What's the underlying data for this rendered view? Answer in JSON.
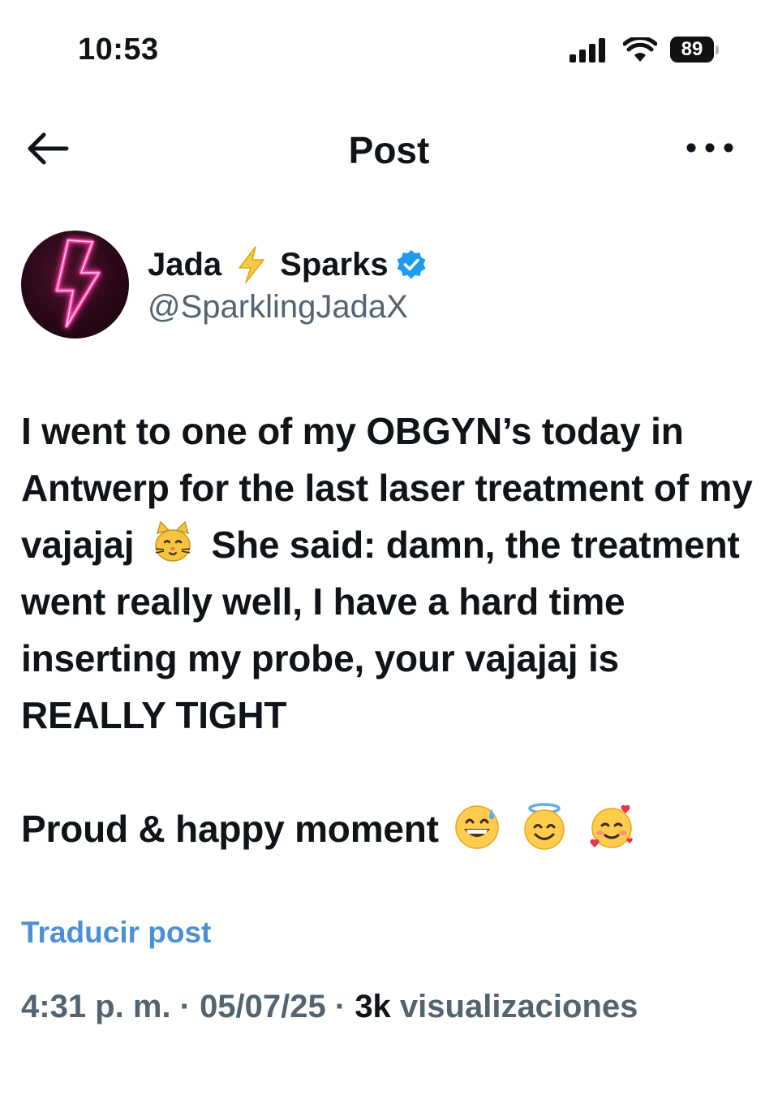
{
  "status_bar": {
    "time": "10:53",
    "battery": "89"
  },
  "nav": {
    "title": "Post"
  },
  "author": {
    "first_name": "Jada",
    "last_name": "Sparks",
    "handle": "@SparklingJadaX",
    "verified_color": "#1d9bf0"
  },
  "tweet": {
    "paragraph1_a": "I went to one of my OBGYN’s today in Antwerp for the last laser treatment of my vajajaj",
    "paragraph1_b": "She said: damn, the treatment went really well, I have a hard time inserting my probe, your vajajaj is REALLY TIGHT",
    "paragraph2": "Proud & happy moment"
  },
  "translate_label": "Traducir post",
  "meta": {
    "time": "4:31 p. m.",
    "sep1": " · ",
    "date": "05/07/25",
    "sep2": " · ",
    "views": "3k",
    "views_label": " visualizaciones"
  },
  "colors": {
    "link": "#4a90d9",
    "muted": "#536471",
    "text": "#0f1419"
  }
}
